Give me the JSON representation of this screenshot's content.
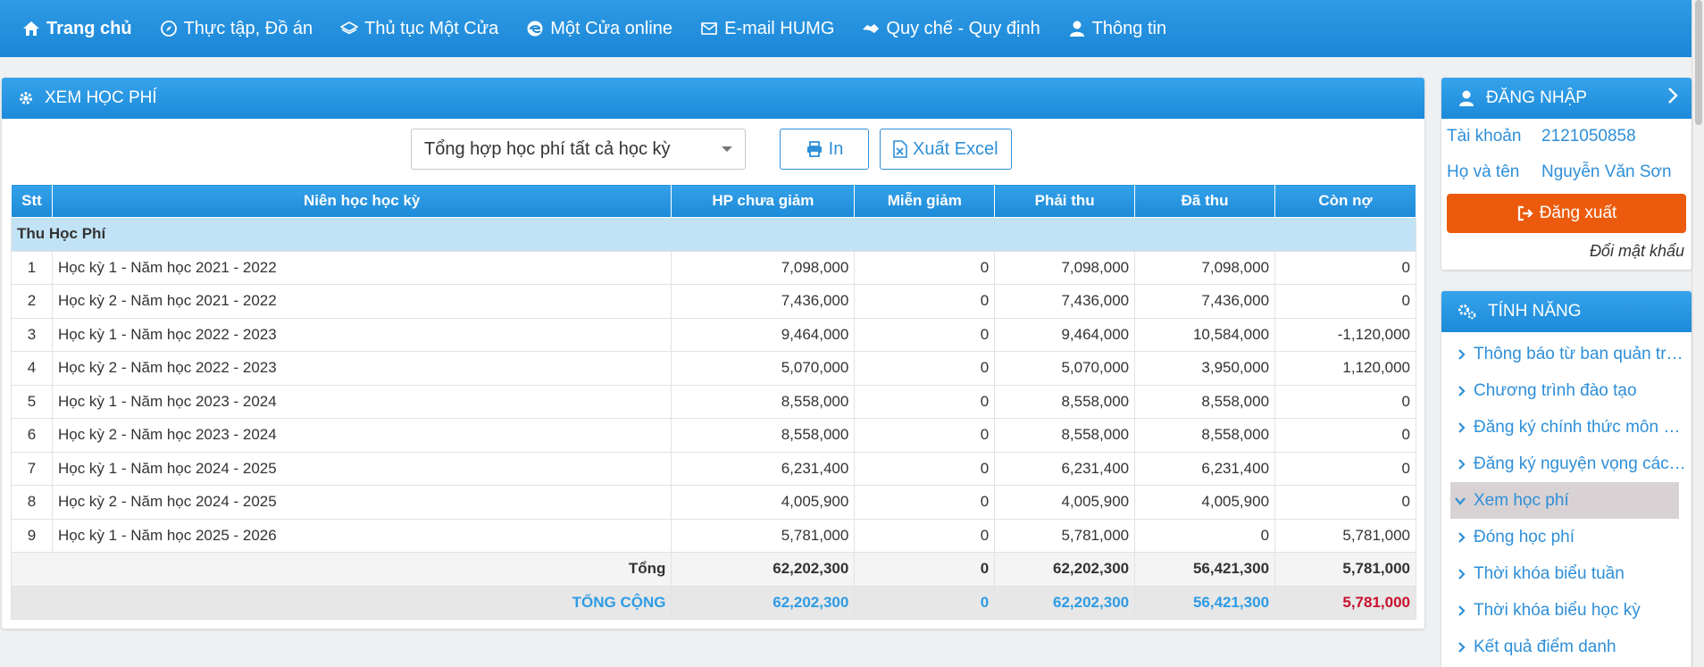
{
  "nav": [
    {
      "label": "Trang chủ",
      "icon": "home-icon"
    },
    {
      "label": "Thực tập, Đồ án",
      "icon": "compass-icon"
    },
    {
      "label": "Thủ tục Một Cửa",
      "icon": "layers-icon"
    },
    {
      "label": "Một Cửa online",
      "icon": "edge-icon"
    },
    {
      "label": "E-mail HUMG",
      "icon": "mail-icon"
    },
    {
      "label": "Quy chế - Quy định",
      "icon": "handshake-icon"
    },
    {
      "label": "Thông tin",
      "icon": "user-icon"
    }
  ],
  "main": {
    "title": "XEM HỌC PHÍ",
    "select_value": "Tổng hợp học phí tất cả học kỳ",
    "print_label": "In",
    "excel_label": "Xuất Excel",
    "columns": [
      "Stt",
      "Niên học học kỳ",
      "HP chưa giảm",
      "Miễn giảm",
      "Phải thu",
      "Đã thu",
      "Còn nợ"
    ],
    "group_label": "Thu Học Phí",
    "rows": [
      [
        "1",
        "Học kỳ 1 - Năm học 2021 - 2022",
        "7,098,000",
        "0",
        "7,098,000",
        "7,098,000",
        "0"
      ],
      [
        "2",
        "Học kỳ 2 - Năm học 2021 - 2022",
        "7,436,000",
        "0",
        "7,436,000",
        "7,436,000",
        "0"
      ],
      [
        "3",
        "Học kỳ 1 - Năm học 2022 - 2023",
        "9,464,000",
        "0",
        "9,464,000",
        "10,584,000",
        "-1,120,000"
      ],
      [
        "4",
        "Học kỳ 2 - Năm học 2022 - 2023",
        "5,070,000",
        "0",
        "5,070,000",
        "3,950,000",
        "1,120,000"
      ],
      [
        "5",
        "Học kỳ 1 - Năm học 2023 - 2024",
        "8,558,000",
        "0",
        "8,558,000",
        "8,558,000",
        "0"
      ],
      [
        "6",
        "Học kỳ 2 - Năm học 2023 - 2024",
        "8,558,000",
        "0",
        "8,558,000",
        "8,558,000",
        "0"
      ],
      [
        "7",
        "Học kỳ 1 - Năm học 2024 - 2025",
        "6,231,400",
        "0",
        "6,231,400",
        "6,231,400",
        "0"
      ],
      [
        "8",
        "Học kỳ 2 - Năm học 2024 - 2025",
        "4,005,900",
        "0",
        "4,005,900",
        "4,005,900",
        "0"
      ],
      [
        "9",
        "Học kỳ 1 - Năm học 2025 - 2026",
        "5,781,000",
        "0",
        "5,781,000",
        "0",
        "5,781,000"
      ]
    ],
    "sum": {
      "label": "Tổng",
      "values": [
        "62,202,300",
        "0",
        "62,202,300",
        "56,421,300",
        "5,781,000"
      ]
    },
    "grand": {
      "label": "TỔNG CỘNG",
      "values": [
        "62,202,300",
        "0",
        "62,202,300",
        "56,421,300",
        "5,781,000"
      ]
    }
  },
  "login": {
    "title": "ĐĂNG NHẬP",
    "account_label": "Tài khoản",
    "account_value": "2121050858",
    "name_label": "Họ và tên",
    "name_value": "Nguyễn Văn Sơn",
    "logout_label": "Đăng xuất",
    "change_password": "Đổi mật khẩu"
  },
  "features": {
    "title": "TÍNH NĂNG",
    "items": [
      "Thông báo từ ban quản trị ...",
      "Chương trình đào tạo",
      "Đăng ký chính thức môn h...",
      "Đăng ký nguyện vọng các ...",
      "Xem học phí",
      "Đóng học phí",
      "Thời khóa biểu tuần",
      "Thời khóa biểu học kỳ",
      "Kết quả điểm danh"
    ],
    "active_index": 4
  },
  "colors": {
    "primary": "#1d8ad8",
    "logout": "#ec5b0d",
    "debt": "#c8102e"
  }
}
